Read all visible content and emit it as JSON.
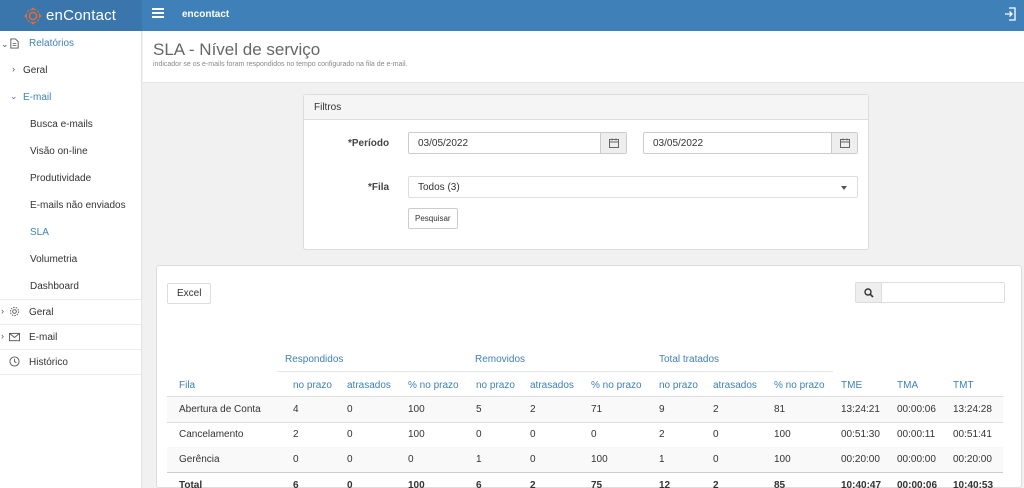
{
  "header": {
    "brand": "enContact",
    "title": "encontact"
  },
  "sidebar": {
    "relatorios": "Relatórios",
    "sub_geral": "Geral",
    "email_group": "E-mail",
    "email_items": [
      "Busca e-mails",
      "Visão on-line",
      "Produtividade",
      "E-mails não enviados",
      "SLA",
      "Volumetria",
      "Dashboard"
    ],
    "geral": "Geral",
    "email": "E-mail",
    "historico": "Histórico"
  },
  "page": {
    "title": "SLA - Nível de serviço",
    "subtitle": "indicador se os e-mails foram respondidos no tempo configurado na fila de e-mail."
  },
  "filters": {
    "heading": "Filtros",
    "periodo_label": "*Período",
    "date_from": "03/05/2022",
    "date_to": "03/05/2022",
    "fila_label": "*Fila",
    "fila_value": "Todos (3)",
    "search_button": "Pesquisar"
  },
  "results": {
    "excel_button": "Excel",
    "search_value": "",
    "groups": [
      "Respondidos",
      "Removidos",
      "Total tratados"
    ],
    "columns": [
      "Fila",
      "no prazo",
      "atrasados",
      "% no prazo",
      "no prazo",
      "atrasados",
      "% no prazo",
      "no prazo",
      "atrasados",
      "% no prazo",
      "TME",
      "TMA",
      "TMT"
    ],
    "rows": [
      [
        "Abertura de Conta",
        "4",
        "0",
        "100",
        "5",
        "2",
        "71",
        "9",
        "2",
        "81",
        "13:24:21",
        "00:00:06",
        "13:24:28"
      ],
      [
        "Cancelamento",
        "2",
        "0",
        "100",
        "0",
        "0",
        "0",
        "2",
        "0",
        "100",
        "00:51:30",
        "00:00:11",
        "00:51:41"
      ],
      [
        "Gerência",
        "0",
        "0",
        "0",
        "1",
        "0",
        "100",
        "1",
        "0",
        "100",
        "00:20:00",
        "00:00:00",
        "00:20:00"
      ]
    ],
    "total": [
      "Total",
      "6",
      "0",
      "100",
      "6",
      "2",
      "75",
      "12",
      "2",
      "85",
      "10:40:47",
      "00:00:06",
      "10:40:53"
    ]
  }
}
